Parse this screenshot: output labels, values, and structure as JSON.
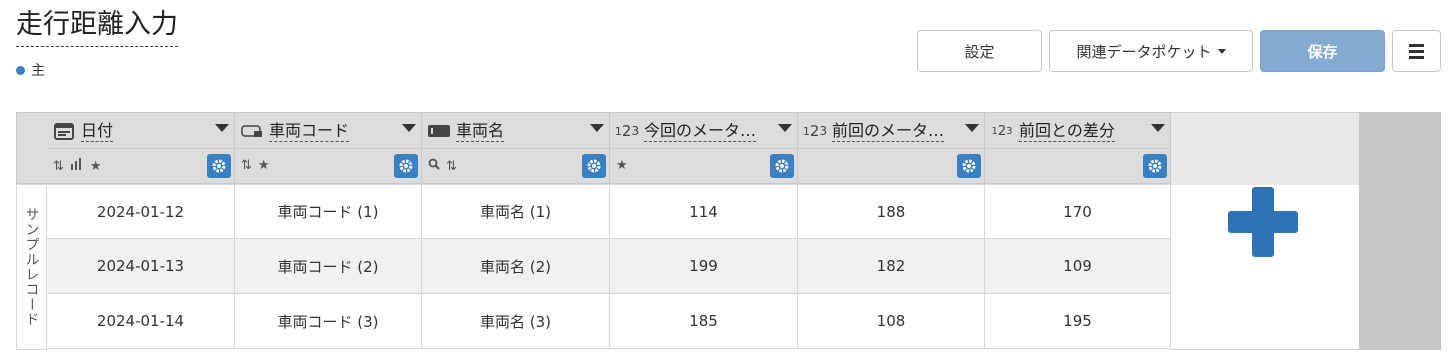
{
  "header": {
    "title": "走行距離入力",
    "sub_label": "主",
    "accent_color": "#3a7fc1"
  },
  "toolbar": {
    "settings_label": "設定",
    "related_label": "関連データポケット",
    "save_label": "保存"
  },
  "columns": [
    {
      "label": "日付",
      "icon": "calendar-icon",
      "tools": [
        "sort-icon",
        "chart-icon",
        "star-icon"
      ]
    },
    {
      "label": "車両コード",
      "icon": "code-field-icon",
      "tools": [
        "sort-icon",
        "star-icon"
      ]
    },
    {
      "label": "車両名",
      "icon": "text-field-icon",
      "tools": [
        "search-icon",
        "sort-icon"
      ]
    },
    {
      "label": "今回のメータ…",
      "icon": "number-icon",
      "tools": [
        "star-icon"
      ]
    },
    {
      "label": "前回のメータ…",
      "icon": "number-icon",
      "tools": []
    },
    {
      "label": "前回との差分",
      "icon": "calculated-number-icon",
      "tools": []
    }
  ],
  "row_group_label": "サンプルレコード",
  "rows": [
    [
      "2024-01-12",
      "車両コード (1)",
      "車両名 (1)",
      "114",
      "188",
      "170"
    ],
    [
      "2024-01-13",
      "車両コード (2)",
      "車両名 (2)",
      "199",
      "182",
      "109"
    ],
    [
      "2024-01-14",
      "車両コード (3)",
      "車両名 (3)",
      "185",
      "108",
      "195"
    ]
  ]
}
